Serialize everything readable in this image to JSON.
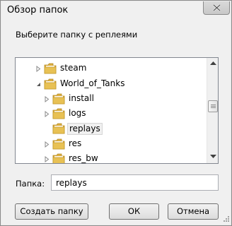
{
  "window": {
    "title": "Обзор папок",
    "close_icon": "close-icon"
  },
  "prompt": "Выберите папку с реплеями",
  "tree": {
    "items": [
      {
        "label": "steam",
        "expander": "collapsed",
        "selected": false
      },
      {
        "label": "World_of_Tanks",
        "expander": "expanded",
        "selected": false
      },
      {
        "label": "install",
        "expander": "collapsed",
        "selected": false
      },
      {
        "label": "logs",
        "expander": "collapsed",
        "selected": false
      },
      {
        "label": "replays",
        "expander": "none",
        "selected": true
      },
      {
        "label": "res",
        "expander": "collapsed",
        "selected": false
      },
      {
        "label": "res_bw",
        "expander": "collapsed",
        "selected": false
      }
    ]
  },
  "folder_field": {
    "label": "Папка:",
    "value": "replays"
  },
  "buttons": {
    "create": "Создать папку",
    "ok": "ОК",
    "cancel": "Отмена"
  },
  "colors": {
    "folder": "#e8c154",
    "selection": "#f0f0f0",
    "border": "#828790"
  }
}
